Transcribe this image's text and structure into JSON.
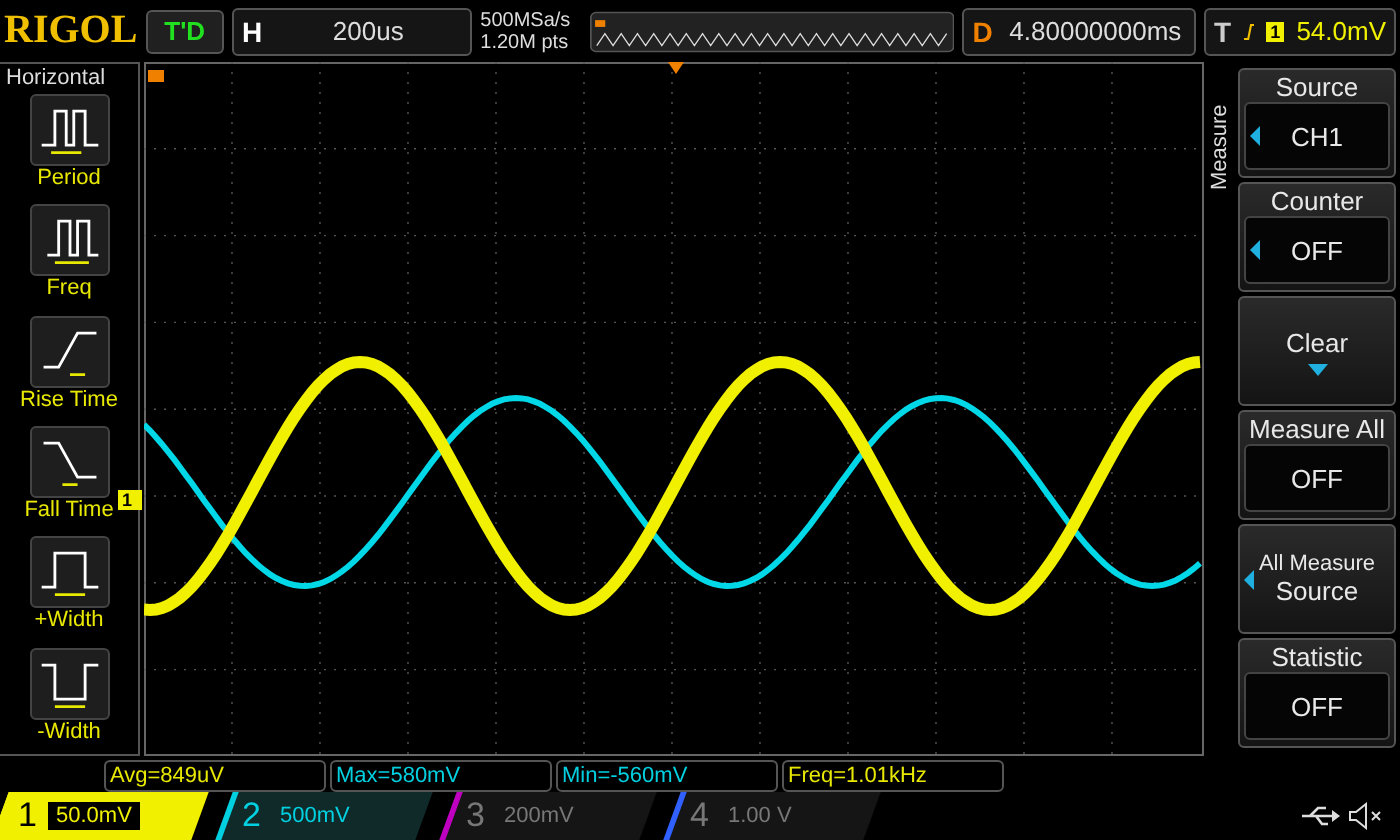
{
  "top_bar": {
    "logo": "RIGOL",
    "status": "T'D",
    "horizontal": {
      "label": "H",
      "value": "200us"
    },
    "sample_rate": "500MSa/s",
    "memory_depth": "1.20M pts",
    "delay": {
      "label": "D",
      "value": "4.80000000ms"
    },
    "trigger": {
      "label": "T",
      "source": "1",
      "level": "54.0mV"
    }
  },
  "left_panel": {
    "title": "Horizontal",
    "items": [
      {
        "label": "Period"
      },
      {
        "label": "Freq"
      },
      {
        "label": "Rise Time"
      },
      {
        "label": "Fall Time"
      },
      {
        "label": "+Width"
      },
      {
        "label": "-Width"
      }
    ]
  },
  "waveform": {
    "channel_marker": "1"
  },
  "right_panel": {
    "tab": "Measure",
    "keys": [
      {
        "kind": "option",
        "title": "Source",
        "value": "CH1",
        "arrow": true
      },
      {
        "kind": "option",
        "title": "Counter",
        "value": "OFF",
        "arrow": true
      },
      {
        "kind": "action",
        "title": "Clear"
      },
      {
        "kind": "option",
        "title": "Measure All",
        "value": "OFF",
        "arrow": false
      },
      {
        "kind": "select",
        "title": "All Measure",
        "value": "Source",
        "arrow": true
      },
      {
        "kind": "option",
        "title": "Statistic",
        "value": "OFF",
        "arrow": false
      }
    ]
  },
  "measurements": [
    {
      "text": "Avg=849uV",
      "color": "#e8e800"
    },
    {
      "text": "Max=580mV",
      "color": "#00d0e0"
    },
    {
      "text": "Min=-560mV",
      "color": "#00d0e0"
    },
    {
      "text": "Freq=1.01kHz",
      "color": "#e8e800"
    }
  ],
  "channels": [
    {
      "number": "1",
      "scale": "50.0mV",
      "on": true,
      "color": "#f0f000"
    },
    {
      "number": "2",
      "scale": "500mV",
      "on": true,
      "color": "#00d0e0"
    },
    {
      "number": "3",
      "scale": "200mV",
      "on": false,
      "color": "#c000c0"
    },
    {
      "number": "4",
      "scale": "1.00 V",
      "on": false,
      "color": "#3060ff"
    }
  ]
}
